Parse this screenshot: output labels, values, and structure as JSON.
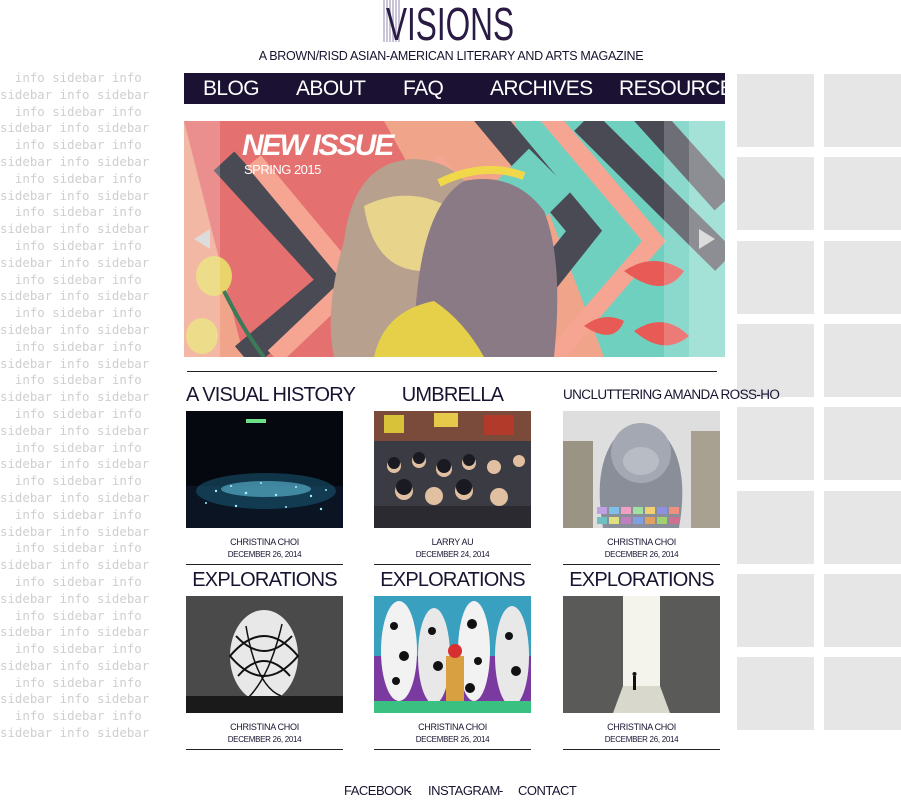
{
  "header": {
    "logo_text": "VISIONS",
    "tagline": "A BROWN/RISD ASIAN-AMERICAN LITERARY AND ARTS MAGAZINE"
  },
  "nav": {
    "items": [
      {
        "label": "BLOG"
      },
      {
        "label": "ABOUT"
      },
      {
        "label": "FAQ"
      },
      {
        "label": "ARCHIVES"
      },
      {
        "label": "RESOURCES"
      }
    ]
  },
  "sidebar": {
    "placeholder_text": "info sidebar info sidebar info sidebar"
  },
  "hero": {
    "title": "NEW ISSUE",
    "subtitle": "SPRING 2015"
  },
  "posts": [
    {
      "title": "A VISUAL HISTORY",
      "author": "CHRISTINA CHOI",
      "date": "DECEMBER 26, 2014"
    },
    {
      "title": "UMBRELLA",
      "author": "LARRY AU",
      "date": "DECEMBER 24, 2014"
    },
    {
      "title": "UNCLUTTERING AMANDA ROSS-HO",
      "author": "CHRISTINA CHOI",
      "date": "DECEMBER 26, 2014"
    },
    {
      "title": "EXPLORATIONS",
      "author": "CHRISTINA CHOI",
      "date": "DECEMBER 26, 2014"
    },
    {
      "title": "EXPLORATIONS",
      "author": "CHRISTINA CHOI",
      "date": "DECEMBER 26, 2014"
    },
    {
      "title": "EXPLORATIONS",
      "author": "CHRISTINA CHOI",
      "date": "DECEMBER 26, 2014"
    }
  ],
  "footer": {
    "links": [
      {
        "label": "FACEBOOK"
      },
      {
        "label": "INSTAGRAM"
      },
      {
        "label": "CONTACT"
      }
    ],
    "separator": "-"
  },
  "colors": {
    "nav_bg": "#1b1233",
    "text": "#1a1330",
    "grid_cell": "#e6e6e6",
    "sidebar_text": "#cfcfcf"
  }
}
